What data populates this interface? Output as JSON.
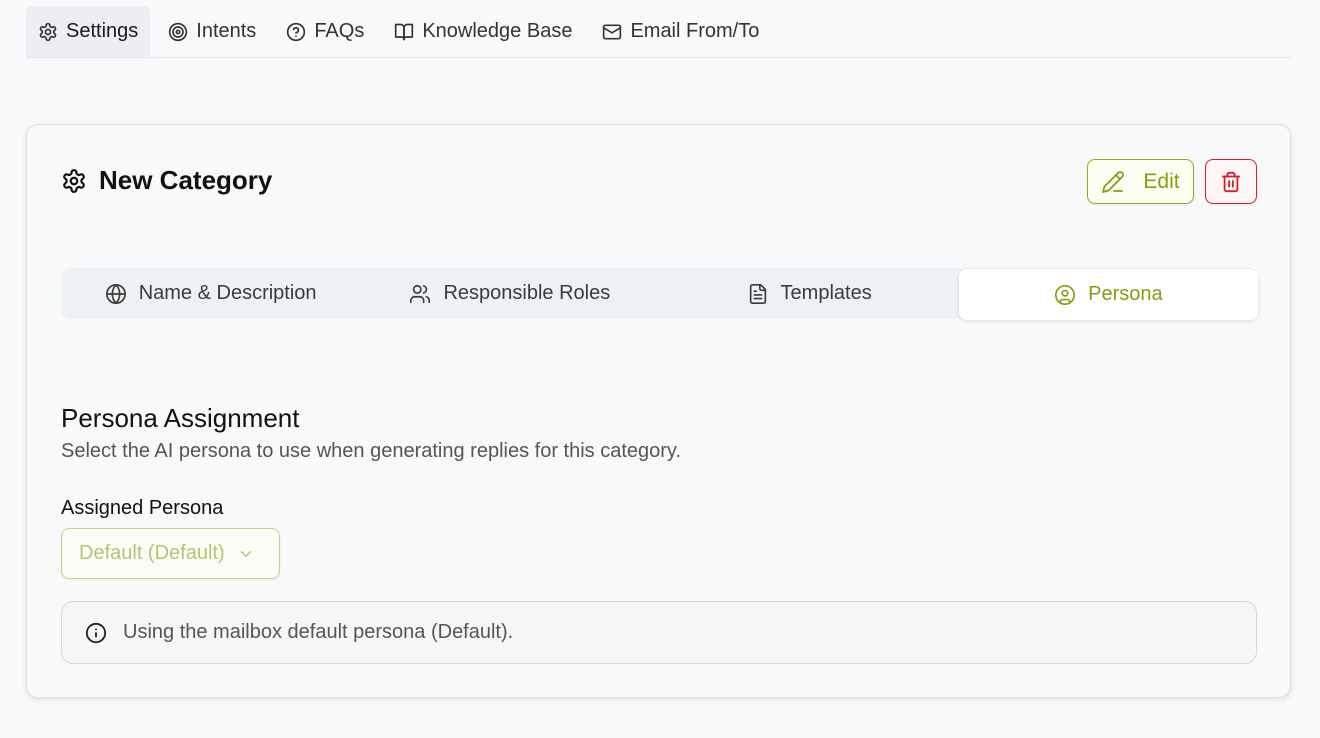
{
  "topnav": {
    "tabs": [
      {
        "label": "Settings",
        "icon": "gear-icon",
        "active": true
      },
      {
        "label": "Intents",
        "icon": "target-icon",
        "active": false
      },
      {
        "label": "FAQs",
        "icon": "help-circle-icon",
        "active": false
      },
      {
        "label": "Knowledge Base",
        "icon": "book-icon",
        "active": false
      },
      {
        "label": "Email From/To",
        "icon": "mail-icon",
        "active": false
      }
    ]
  },
  "card": {
    "title": "New Category",
    "edit_label": "Edit",
    "subtabs": [
      {
        "label": "Name & Description",
        "icon": "globe-icon",
        "active": false
      },
      {
        "label": "Responsible Roles",
        "icon": "users-icon",
        "active": false
      },
      {
        "label": "Templates",
        "icon": "file-text-icon",
        "active": false
      },
      {
        "label": "Persona",
        "icon": "user-circle-icon",
        "active": true
      }
    ],
    "section_title": "Persona Assignment",
    "section_description": "Select the AI persona to use when generating replies for this category.",
    "field_label": "Assigned Persona",
    "selected_persona": "Default (Default)",
    "info_text": "Using the mailbox default persona (Default)."
  },
  "colors": {
    "accent": "#8a9a12",
    "danger": "#d21d2e",
    "background": "#f7f9fb"
  }
}
